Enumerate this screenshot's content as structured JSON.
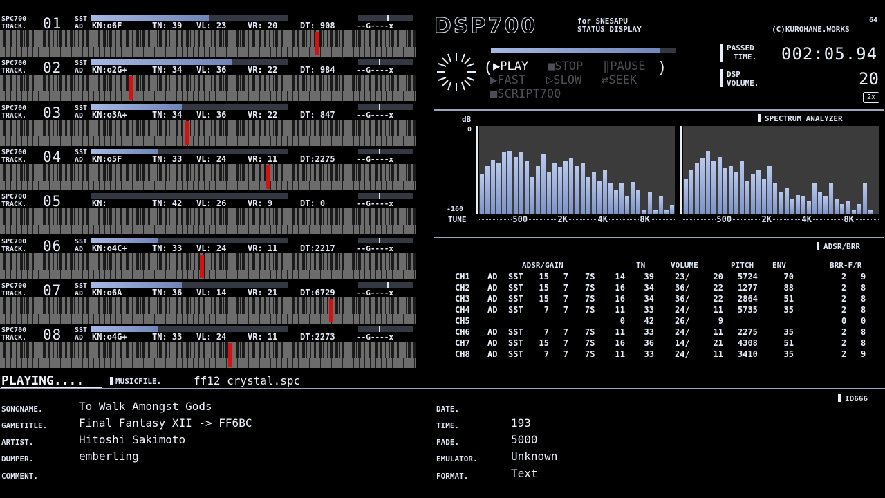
{
  "tracks": [
    {
      "label": "SPC700\nTRACK.",
      "num": "01",
      "sst": "SST",
      "ad": "AD",
      "kn": "KN:o6F",
      "tn": "TN: 39",
      "vl": "VL: 23",
      "vr": "VR: 20",
      "dt": "DT: 908",
      "pan": "--G----x",
      "env_level": 0.6,
      "pan_pos": 0.52,
      "note_pos": 0.76
    },
    {
      "label": "SPC700\nTRACK.",
      "num": "02",
      "sst": "SST",
      "ad": "AD",
      "kn": "KN:o2G+",
      "tn": "TN: 34",
      "vl": "VL: 36",
      "vr": "VR: 22",
      "dt": "DT: 984",
      "pan": "--G----x",
      "env_level": 0.72,
      "pan_pos": 0.38,
      "note_pos": 0.315
    },
    {
      "label": "SPC700\nTRACK.",
      "num": "03",
      "sst": "SST",
      "ad": "AD",
      "kn": "KN:o3A+",
      "tn": "TN: 34",
      "vl": "VL: 36",
      "vr": "VR: 22",
      "dt": "DT: 847",
      "pan": "--G----x",
      "env_level": 0.46,
      "pan_pos": 0.38,
      "note_pos": 0.45
    },
    {
      "label": "SPC700\nTRACK.",
      "num": "04",
      "sst": "SST",
      "ad": "AD",
      "kn": "KN:o5F",
      "tn": "TN: 33",
      "vl": "VL: 24",
      "vr": "VR: 11",
      "dt": "DT:2275",
      "pan": "--G----x",
      "env_level": 0.34,
      "pan_pos": 0.38,
      "note_pos": 0.645
    },
    {
      "label": "SPC700\nTRACK.",
      "num": "05",
      "sst": "",
      "ad": "",
      "kn": "KN:",
      "tn": "TN: 42",
      "vl": "VL: 26",
      "vr": "VR: 9",
      "dt": "DT: 0",
      "pan": "--G----x",
      "env_level": 0.0,
      "pan_pos": 0.38,
      "note_pos": -1
    },
    {
      "label": "SPC700\nTRACK.",
      "num": "06",
      "sst": "SST",
      "ad": "AD",
      "kn": "KN:o4C+",
      "tn": "TN: 33",
      "vl": "VL: 24",
      "vr": "VR: 11",
      "dt": "DT:2217",
      "pan": "--G----x",
      "env_level": 0.34,
      "pan_pos": 0.38,
      "note_pos": 0.485
    },
    {
      "label": "SPC700\nTRACK.",
      "num": "07",
      "sst": "SST",
      "ad": "AD",
      "kn": "KN:o6A",
      "tn": "TN: 36",
      "vl": "VL: 14",
      "vr": "VR: 21",
      "dt": "DT:6729",
      "pan": "--G----x",
      "env_level": 0.46,
      "pan_pos": 0.52,
      "note_pos": 0.795
    },
    {
      "label": "SPC700\nTRACK.",
      "num": "08",
      "sst": "SST",
      "ad": "AD",
      "kn": "KN:o4G+",
      "tn": "TN: 33",
      "vl": "VL: 24",
      "vr": "VR: 11",
      "dt": "DT:2273",
      "pan": "--G----x",
      "env_level": 0.34,
      "pan_pos": 0.38,
      "note_pos": 0.553
    }
  ],
  "header": {
    "title": "DSP700",
    "subtitle1": "for SNESAPU",
    "subtitle2": "STATUS DISPLAY",
    "credit_num": "64",
    "credit": "(C)KUROHANE.WORKS"
  },
  "transport": {
    "play": "PLAY",
    "stop": "STOP",
    "pause": "PAUSE",
    "fast": "FAST",
    "slow": "SLOW",
    "seek": "SEEK",
    "script": "SCRIPT700",
    "progress": 0.91
  },
  "status": {
    "passed_label1": "PASSED",
    "passed_label2": "TIME.",
    "passed_time": "002:05.94",
    "dsp_label1": "DSP",
    "dsp_label2": "VOLUME.",
    "dsp_volume": "20",
    "mult": "2x"
  },
  "spectrum": {
    "title": "SPECTRUM ANALYZER",
    "db_label": "dB",
    "top_db": "0",
    "bottom_db": "-160",
    "tune_label": "TUNE",
    "ticks": [
      "500",
      "2K",
      "4K",
      "8K"
    ],
    "left": [
      45,
      55,
      62,
      58,
      70,
      72,
      65,
      70,
      60,
      42,
      55,
      68,
      48,
      58,
      53,
      60,
      63,
      55,
      58,
      42,
      48,
      38,
      50,
      35,
      28,
      35,
      20,
      37,
      28,
      5,
      25,
      5,
      20,
      5,
      10
    ],
    "right": [
      40,
      50,
      58,
      63,
      72,
      60,
      65,
      52,
      55,
      48,
      60,
      38,
      45,
      50,
      40,
      55,
      35,
      25,
      30,
      18,
      22,
      20,
      15,
      35,
      25,
      20,
      35,
      18,
      12,
      15,
      5,
      12,
      35,
      5,
      0
    ]
  },
  "adsr": {
    "title": "ADSR/BRR",
    "headers": {
      "adsr": "ADSR/GAIN",
      "tn": "TN",
      "volume": "VOLUME",
      "pitch": "PITCH",
      "env": "ENV",
      "brr": "BRR-F/R"
    },
    "rows": [
      {
        "ch": "CH1",
        "ad": "AD",
        "sst": "SST",
        "a": "15",
        "d": "7",
        "s": "7S",
        "r": "14",
        "tn": "39",
        "vl": "23/",
        "vr": "20",
        "pitch": "5724",
        "env": "70",
        "bf": "2",
        "br": "9"
      },
      {
        "ch": "CH2",
        "ad": "AD",
        "sst": "SST",
        "a": "15",
        "d": "7",
        "s": "7S",
        "r": "16",
        "tn": "34",
        "vl": "36/",
        "vr": "22",
        "pitch": "1277",
        "env": "88",
        "bf": "2",
        "br": "8"
      },
      {
        "ch": "CH3",
        "ad": "AD",
        "sst": "SST",
        "a": "15",
        "d": "7",
        "s": "7S",
        "r": "16",
        "tn": "34",
        "vl": "36/",
        "vr": "22",
        "pitch": "2864",
        "env": "51",
        "bf": "2",
        "br": "8"
      },
      {
        "ch": "CH4",
        "ad": "AD",
        "sst": "SST",
        "a": "7",
        "d": "7",
        "s": "7S",
        "r": "11",
        "tn": "33",
        "vl": "24/",
        "vr": "11",
        "pitch": "5735",
        "env": "35",
        "bf": "2",
        "br": "8"
      },
      {
        "ch": "CH5",
        "ad": "",
        "sst": "",
        "a": "",
        "d": "",
        "s": "",
        "r": "0",
        "tn": "42",
        "vl": "26/",
        "vr": "9",
        "pitch": "",
        "env": "",
        "bf": "0",
        "br": "0"
      },
      {
        "ch": "CH6",
        "ad": "AD",
        "sst": "SST",
        "a": "7",
        "d": "7",
        "s": "7S",
        "r": "11",
        "tn": "33",
        "vl": "24/",
        "vr": "11",
        "pitch": "2275",
        "env": "35",
        "bf": "2",
        "br": "8"
      },
      {
        "ch": "CH7",
        "ad": "AD",
        "sst": "SST",
        "a": "15",
        "d": "7",
        "s": "7S",
        "r": "16",
        "tn": "36",
        "vl": "14/",
        "vr": "21",
        "pitch": "4308",
        "env": "51",
        "bf": "2",
        "br": "8"
      },
      {
        "ch": "CH8",
        "ad": "AD",
        "sst": "SST",
        "a": "7",
        "d": "7",
        "s": "7S",
        "r": "11",
        "tn": "33",
        "vl": "24/",
        "vr": "11",
        "pitch": "3410",
        "env": "35",
        "bf": "2",
        "br": "9"
      }
    ]
  },
  "file": {
    "playing": "PLAYING....",
    "musicfile_label": "MUSICFILE.",
    "musicfile": "ff12_crystal.spc",
    "id666": "ID666"
  },
  "meta": {
    "songname_label": "SONGNAME.",
    "songname": "To Walk Amongst Gods",
    "gametitle_label": "GAMETITLE.",
    "gametitle": "Final Fantasy XII -> FF6BC",
    "artist_label": "ARTIST.",
    "artist": "Hitoshi Sakimoto",
    "dumper_label": "DUMPER.",
    "dumper": "emberling",
    "comment_label": "COMMENT.",
    "comment": "",
    "date_label": "DATE.",
    "date": "",
    "time_label": "TIME.",
    "time": "193",
    "fade_label": "FADE.",
    "fade": "5000",
    "emulator_label": "EMULATOR.",
    "emulator": "Unknown",
    "format_label": "FORMAT.",
    "format": "Text"
  }
}
